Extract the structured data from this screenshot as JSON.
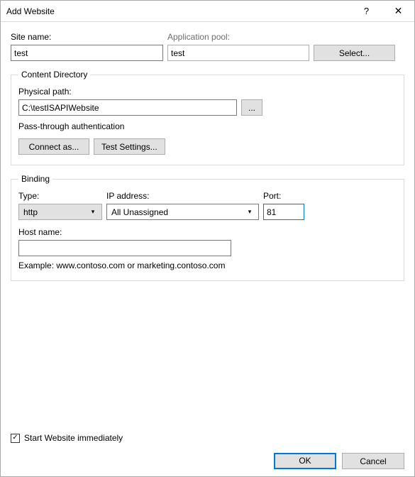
{
  "title": "Add Website",
  "site_name": {
    "label": "Site name:",
    "value": "test"
  },
  "app_pool": {
    "label": "Application pool:",
    "value": "test",
    "select_btn": "Select..."
  },
  "content_dir": {
    "legend": "Content Directory",
    "path_label": "Physical path:",
    "path_value": "C:\\testISAPIWebsite",
    "browse_btn": "...",
    "passthrough": "Pass-through authentication",
    "connect_btn": "Connect as...",
    "test_btn": "Test Settings..."
  },
  "binding": {
    "legend": "Binding",
    "type_label": "Type:",
    "type_value": "http",
    "ip_label": "IP address:",
    "ip_value": "All Unassigned",
    "port_label": "Port:",
    "port_value": "81",
    "host_label": "Host name:",
    "host_value": "",
    "example": "Example: www.contoso.com or marketing.contoso.com"
  },
  "start_checkbox": {
    "label": "Start Website immediately",
    "checked": true
  },
  "ok_btn": "OK",
  "cancel_btn": "Cancel"
}
